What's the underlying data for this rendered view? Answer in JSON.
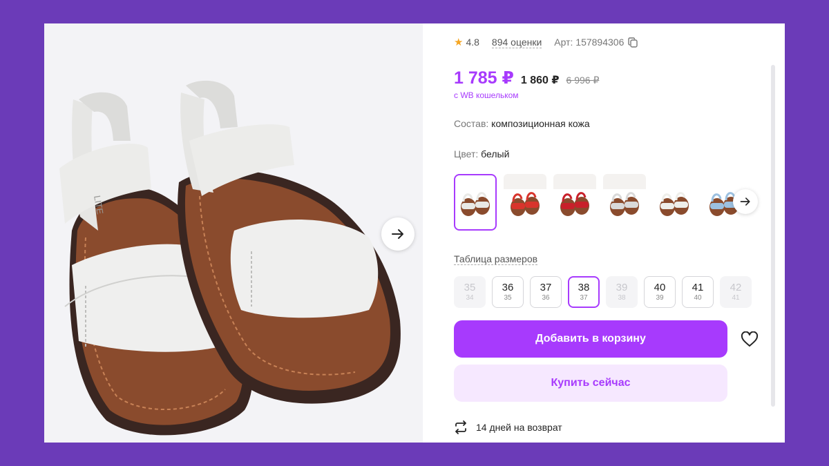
{
  "product": {
    "rating": "4.8",
    "reviews": "894 оценки",
    "article": "Арт: 157894306",
    "price": "1 785 ₽",
    "price_regular": "1 860 ₽",
    "price_old": "6 996 ₽",
    "wallet_note": "с WB кошельком",
    "composition_label": "Состав:",
    "composition_value": "композиционная кожа",
    "color_label": "Цвет:",
    "color_value": "белый",
    "brand_print": "LITE"
  },
  "color_variants": [
    {
      "name": "white",
      "color": "#e9e9e6",
      "selected": true
    },
    {
      "name": "red",
      "color": "#d8342c",
      "selected": false
    },
    {
      "name": "red-dark",
      "color": "#c8202a",
      "selected": false
    },
    {
      "name": "light-grey",
      "color": "#d9d9d9",
      "selected": false
    },
    {
      "name": "white-brown",
      "color": "#eeeeea",
      "selected": false
    },
    {
      "name": "blue",
      "color": "#9cc0e0",
      "selected": false
    }
  ],
  "sizes_title": "Таблица размеров",
  "sizes": [
    {
      "ru": "35",
      "eu": "34",
      "state": "disabled"
    },
    {
      "ru": "36",
      "eu": "35",
      "state": "available"
    },
    {
      "ru": "37",
      "eu": "36",
      "state": "available"
    },
    {
      "ru": "38",
      "eu": "37",
      "state": "selected"
    },
    {
      "ru": "39",
      "eu": "38",
      "state": "disabled"
    },
    {
      "ru": "40",
      "eu": "39",
      "state": "available"
    },
    {
      "ru": "41",
      "eu": "40",
      "state": "available"
    },
    {
      "ru": "42",
      "eu": "41",
      "state": "disabled"
    }
  ],
  "actions": {
    "add_to_cart": "Добавить в корзину",
    "buy_now": "Купить сейчас"
  },
  "returns": "14 дней на возврат",
  "colors": {
    "accent": "#a73afd",
    "frame": "#6b3bb8",
    "accent_soft": "#f6e8ff"
  }
}
